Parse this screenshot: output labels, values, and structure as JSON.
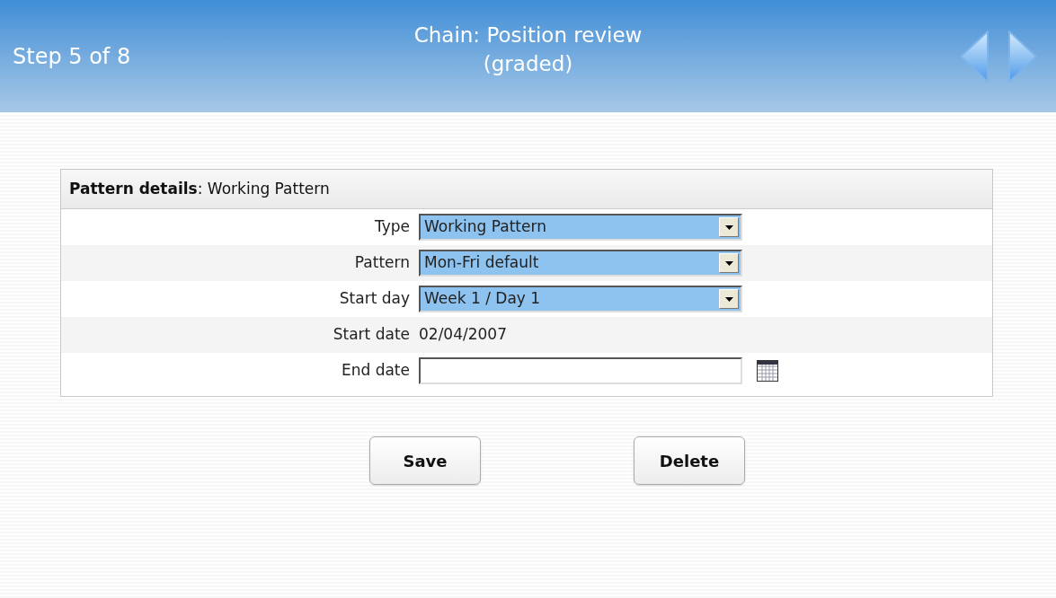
{
  "header": {
    "step": "Step 5 of 8",
    "title_lines": [
      "Chain: Position review",
      "(graded)"
    ]
  },
  "panel": {
    "title": "**Pattern details**: Working Pattern",
    "fields": [
      {
        "kind": "select",
        "label": "Type",
        "value": "Working Pattern"
      },
      {
        "kind": "select",
        "label": "Pattern",
        "value": "Mon-Fri default"
      },
      {
        "kind": "select",
        "label": "Start day",
        "value": "Week 1 / Day 1"
      },
      {
        "kind": "static",
        "label": "Start date",
        "value": "02/04/2007"
      },
      {
        "kind": "date",
        "label": "End date"
      }
    ]
  },
  "buttons": [
    "Save",
    "Delete"
  ]
}
